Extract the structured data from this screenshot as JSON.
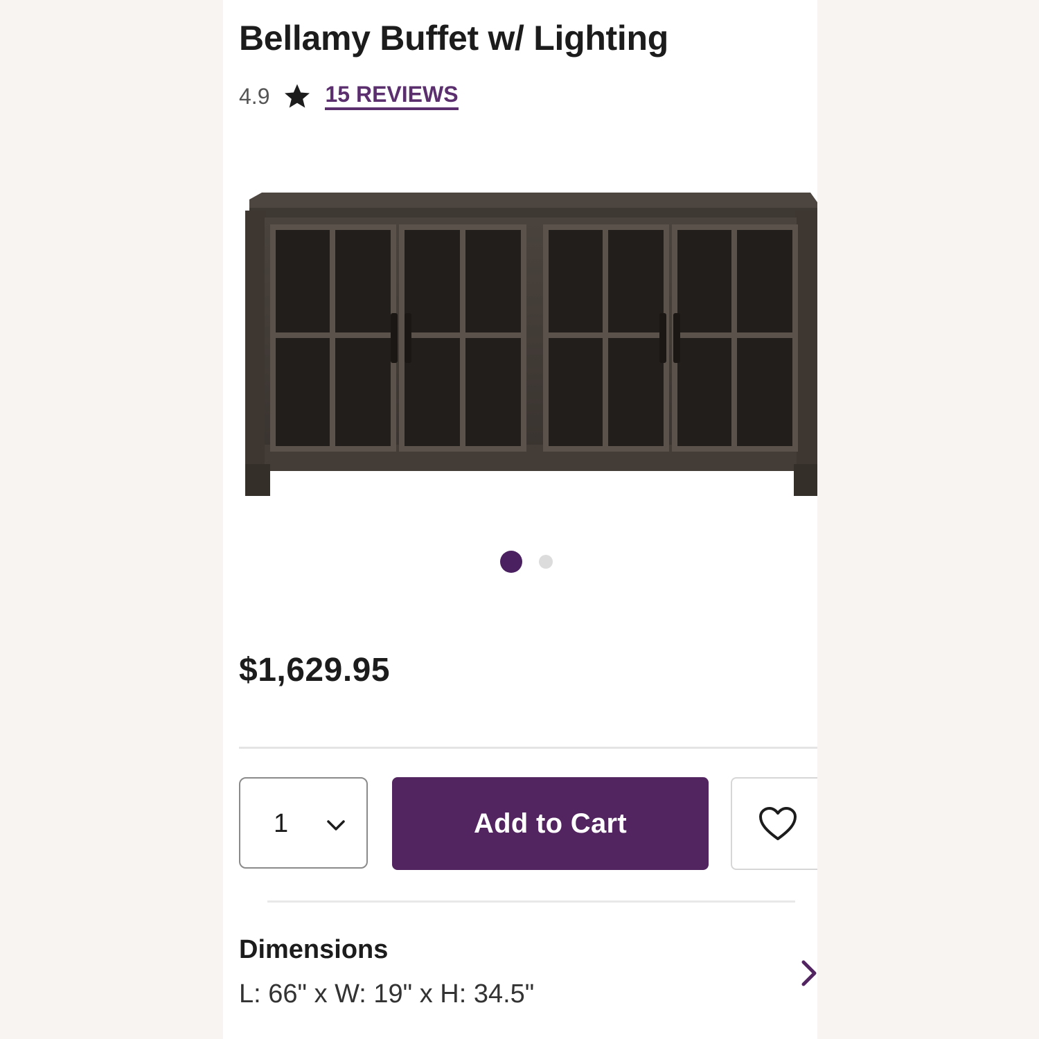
{
  "product": {
    "title": "Bellamy Buffet w/ Lighting",
    "rating": "4.9",
    "reviews_label": "15 REVIEWS",
    "image_icon": "buffet-cabinet-photo",
    "carousel": {
      "total": 2,
      "active": 1
    },
    "price": "$1,629.95"
  },
  "purchase": {
    "quantity": "1",
    "add_to_cart_label": "Add to Cart"
  },
  "dimensions": {
    "heading": "Dimensions",
    "value": "L: 66\" x W: 19\" x H: 34.5\""
  },
  "colors": {
    "brand_purple": "#522460",
    "link_purple": "#5b2f6e",
    "dot_active": "#4a2060",
    "dot_inactive": "#dcdcdc"
  }
}
